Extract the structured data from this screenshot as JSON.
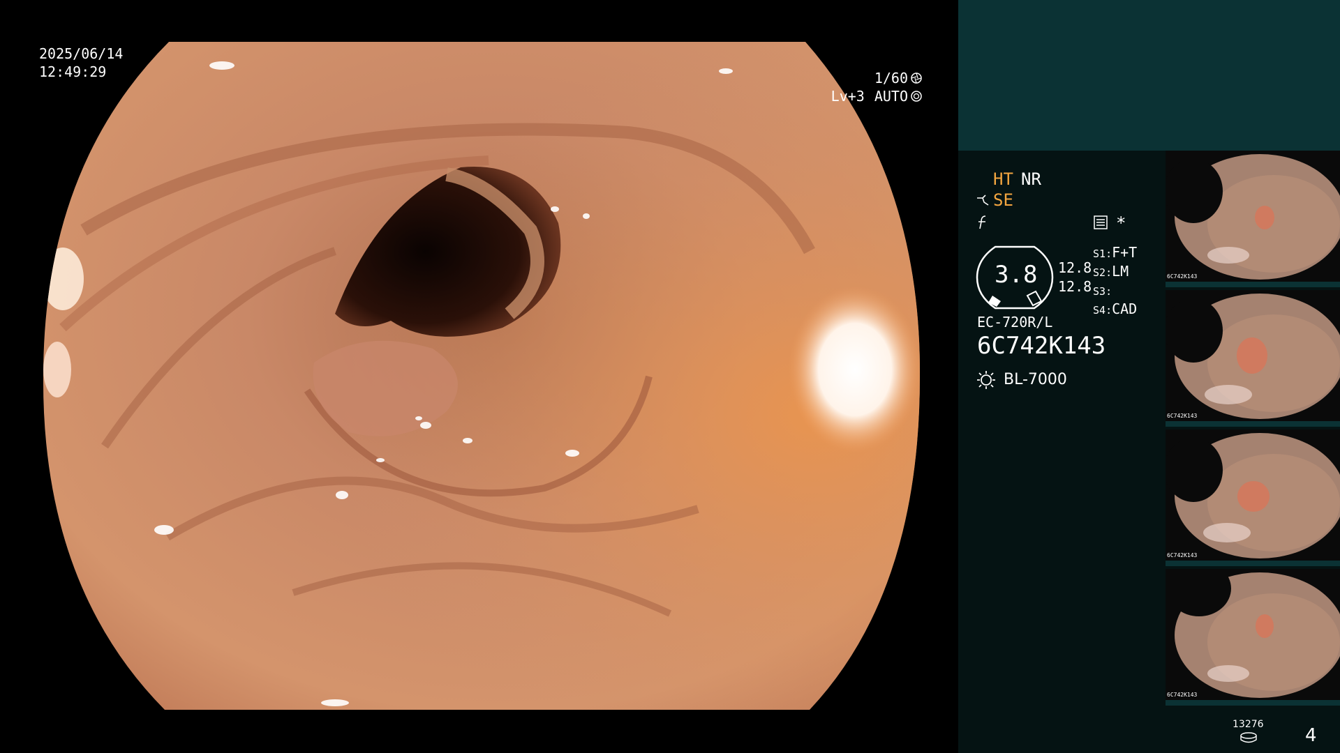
{
  "overlay": {
    "date": "2025/06/14",
    "time": "12:49:29",
    "shutter": "1/60",
    "exposure_level": "Lv+3",
    "exposure_mode": "AUTO",
    "shutter_icon": "aperture-icon",
    "auto_icon": "iris-icon"
  },
  "panel": {
    "ht": "HT",
    "nr": "NR",
    "se": "SE",
    "se_icon": "scope-tip-icon",
    "freeze_icon": "f-hook-icon",
    "settings_icon": "settings-list-icon",
    "asterisk": "*",
    "gauge_value": "3.8",
    "gauge_top": "12.8",
    "gauge_bottom": "12.8",
    "switches": [
      {
        "key": "S1",
        "sep": ":",
        "val": "F+T"
      },
      {
        "key": "S2",
        "sep": ":",
        "val": "LM"
      },
      {
        "key": "S3",
        "sep": ":",
        "val": ""
      },
      {
        "key": "S4",
        "sep": ":",
        "val": "CAD"
      }
    ],
    "scope_model": "EC-720R/L",
    "scope_serial": "6C742K143",
    "light_icon": "light-source-icon",
    "light_source": "BL-7000",
    "storage_count": "13276",
    "storage_icon": "storage-disk-icon",
    "image_count": "4",
    "colors": {
      "panel_bg": "#051313",
      "top_bg": "#0b3234",
      "orange": "#f4a640"
    }
  },
  "thumbnails": [
    {
      "id": "thumb-1",
      "label": "6C742K143"
    },
    {
      "id": "thumb-2",
      "label": "6C742K143"
    },
    {
      "id": "thumb-3",
      "label": "6C742K143"
    },
    {
      "id": "thumb-4",
      "label": "6C742K143"
    }
  ]
}
